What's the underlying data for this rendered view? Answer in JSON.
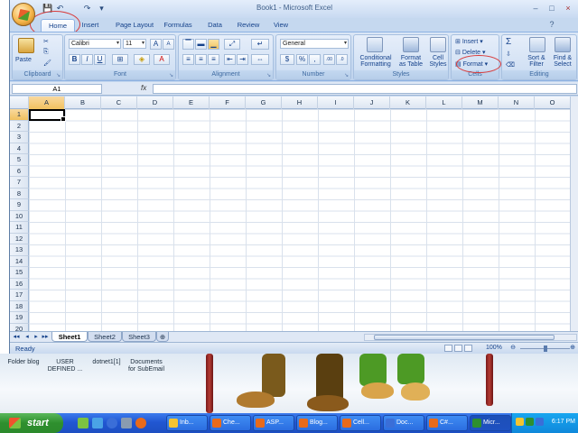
{
  "window": {
    "title": "Book1 - Microsoft Excel",
    "qat": [
      "💾",
      "↶",
      "↷",
      "▾"
    ],
    "controls": [
      "–",
      "□",
      "×"
    ]
  },
  "tabs": [
    "Home",
    "Insert",
    "Page Layout",
    "Formulas",
    "Data",
    "Review",
    "View"
  ],
  "ribbon": {
    "clipboard": {
      "label": "Clipboard",
      "paste": "Paste"
    },
    "font": {
      "label": "Font",
      "font_name": "Calibri",
      "font_size": "11",
      "grow": "A",
      "shrink": "A",
      "bold": "B",
      "italic": "I",
      "underline": "U",
      "fill_letter": "A"
    },
    "alignment": {
      "label": "Alignment"
    },
    "number": {
      "label": "Number",
      "format": "General",
      "currency": "$",
      "percent": "%",
      "comma": ",",
      "inc_dec": ".00",
      "dec_dec": ".0"
    },
    "styles": {
      "label": "Styles",
      "conditional": "Conditional",
      "conditional2": "Formatting",
      "format_as": "Format",
      "format_as2": "as Table",
      "cell": "Cell",
      "cell2": "Styles"
    },
    "cells": {
      "label": "Cells",
      "insert": "Insert",
      "delete": "Delete",
      "format": "Format"
    },
    "editing": {
      "label": "Editing",
      "sum": "Σ",
      "sort": "Sort &",
      "sort2": "Filter",
      "find": "Find &",
      "find2": "Select"
    }
  },
  "formula_bar": {
    "name_box": "A1",
    "fx": "fx",
    "value": ""
  },
  "grid": {
    "columns": [
      "A",
      "B",
      "C",
      "D",
      "E",
      "F",
      "G",
      "H",
      "I",
      "J",
      "K",
      "L",
      "M",
      "N",
      "O"
    ],
    "rows": [
      "1",
      "2",
      "3",
      "4",
      "5",
      "6",
      "7",
      "8",
      "9",
      "10",
      "11",
      "12",
      "13",
      "14",
      "15",
      "16",
      "17",
      "18",
      "19",
      "20"
    ],
    "active_cell": "A1"
  },
  "sheets": {
    "tabs": [
      "Sheet1",
      "Sheet2",
      "Sheet3"
    ],
    "active": "Sheet1",
    "nav": [
      "◂◂",
      "◂",
      "▸",
      "▸▸"
    ]
  },
  "status": {
    "text": "Ready",
    "zoom": "100%",
    "zoom_level_percent": 100
  },
  "desktop": {
    "icons": [
      {
        "label": "Folder blog"
      },
      {
        "label": "USER DEFINED ..."
      },
      {
        "label": "dotnet1[1]"
      },
      {
        "label": "Documents for SubEmail"
      }
    ]
  },
  "taskbar": {
    "start": "start",
    "tasks": [
      {
        "label": "Inb...",
        "color": "#f4c430"
      },
      {
        "label": "Che...",
        "color": "#e86a1a"
      },
      {
        "label": "ASP...",
        "color": "#e86a1a"
      },
      {
        "label": "Blog...",
        "color": "#e86a1a"
      },
      {
        "label": "Cell...",
        "color": "#e86a1a"
      },
      {
        "label": "Doc...",
        "color": "#3a6ed8"
      },
      {
        "label": "C#...",
        "color": "#e86a1a"
      },
      {
        "label": "Micr...",
        "color": "#2e8f2e"
      }
    ],
    "clock": "6:17 PM"
  },
  "colors": {
    "accent": "#15428b",
    "annotation": "#d83a3a",
    "selected_header": "#f1c15f"
  }
}
